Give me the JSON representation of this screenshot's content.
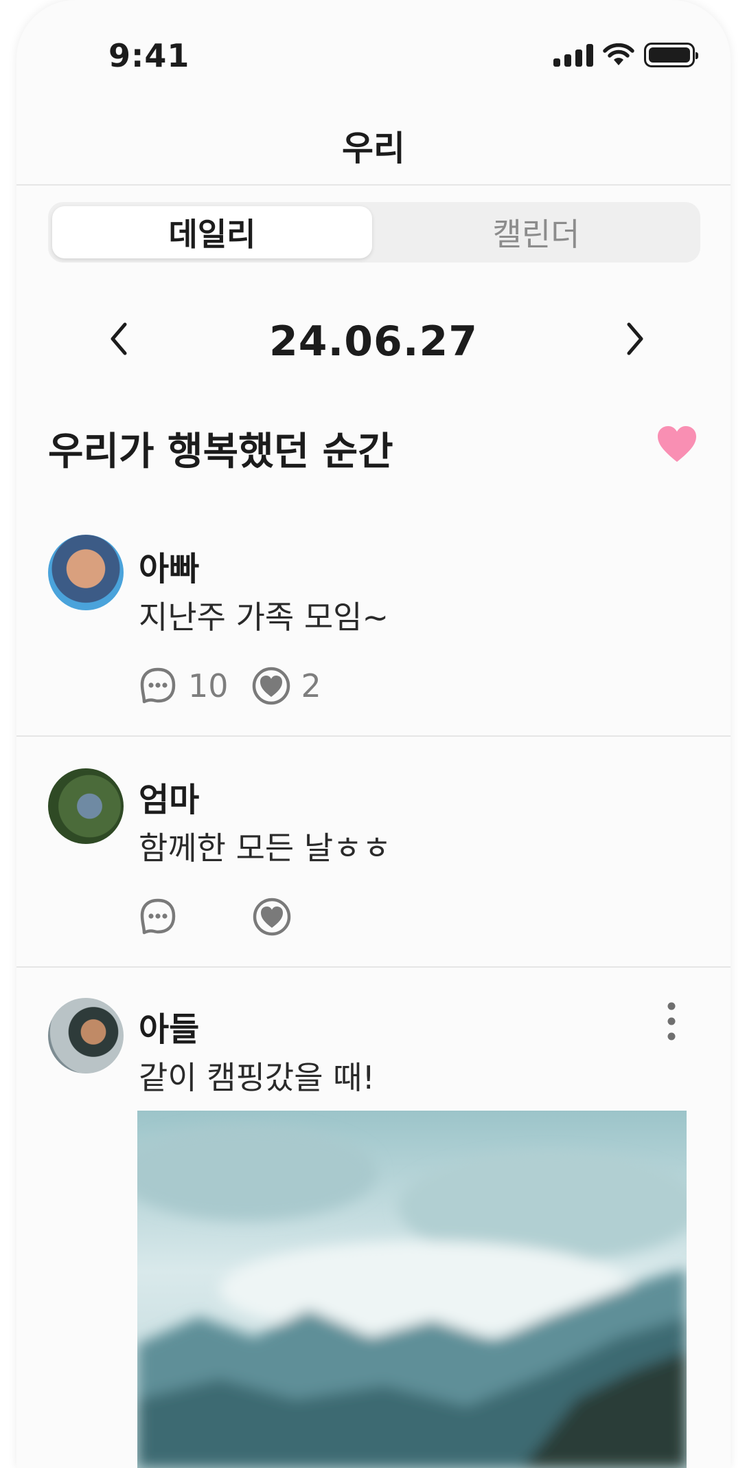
{
  "status_bar": {
    "time": "9:41"
  },
  "header": {
    "title": "우리"
  },
  "tabs": [
    {
      "label": "데일리",
      "active": true
    },
    {
      "label": "캘린더",
      "active": false
    }
  ],
  "date_nav": {
    "date": "24.06.27"
  },
  "section": {
    "title": "우리가 행복했던 순간",
    "heart_color": "#f98fb3"
  },
  "posts": [
    {
      "author": "아빠",
      "text": "지난주 가족 모임~",
      "comment_count": "10",
      "like_count": "2"
    },
    {
      "author": "엄마",
      "text": "함께한 모든 날ㅎㅎ",
      "comment_count": "",
      "like_count": ""
    },
    {
      "author": "아들",
      "text": "같이 캠핑갔을 때!",
      "comment_count": "",
      "like_count": ""
    }
  ],
  "icons": {
    "comment": "comment-bubble-icon",
    "like": "heart-outline-icon",
    "more": "more-vertical-icon",
    "prev": "chevron-left-icon",
    "next": "chevron-right-icon"
  },
  "colors": {
    "accent_heart": "#f98fb3",
    "icon_gray": "#7a7a7a",
    "background": "#fbfbfb"
  }
}
